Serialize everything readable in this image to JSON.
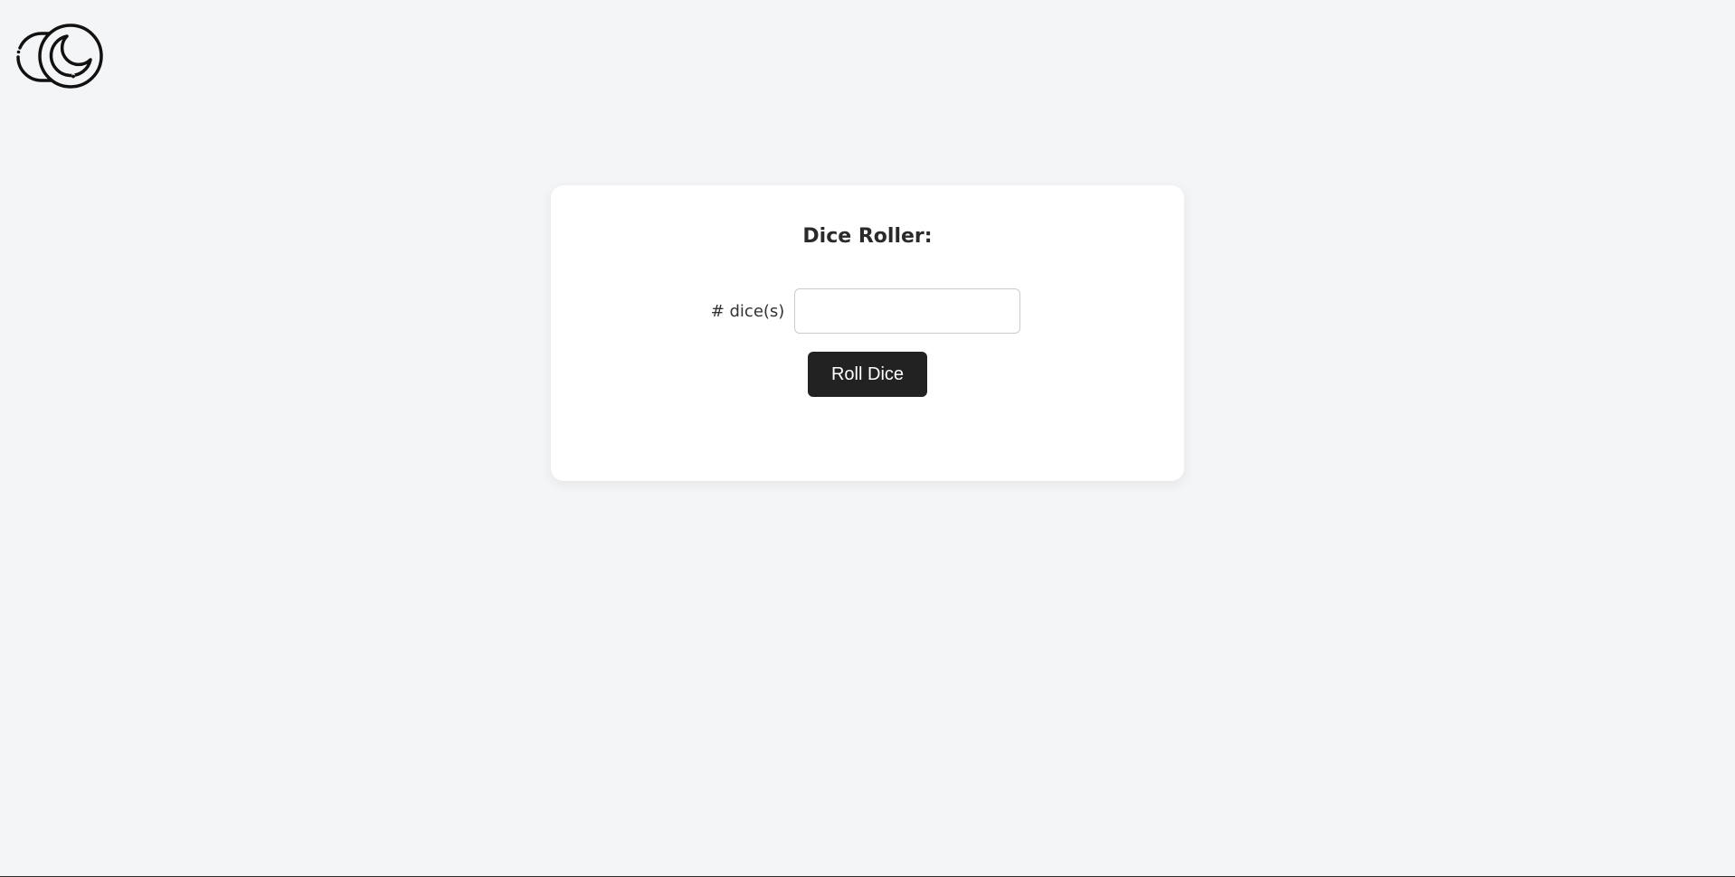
{
  "theme_toggle": {
    "icon": "moon-icon",
    "mode": "light"
  },
  "dice_roller": {
    "title": "Dice Roller:",
    "dice_label": "# dice(s)",
    "dice_input_value": "",
    "dice_input_placeholder": "",
    "roll_button_label": "Roll Dice"
  },
  "colors": {
    "page_background": "#f4f5f7",
    "card_background": "#ffffff",
    "button_background": "#222222",
    "button_text": "#ffffff",
    "title_text": "#2a2a2a"
  }
}
